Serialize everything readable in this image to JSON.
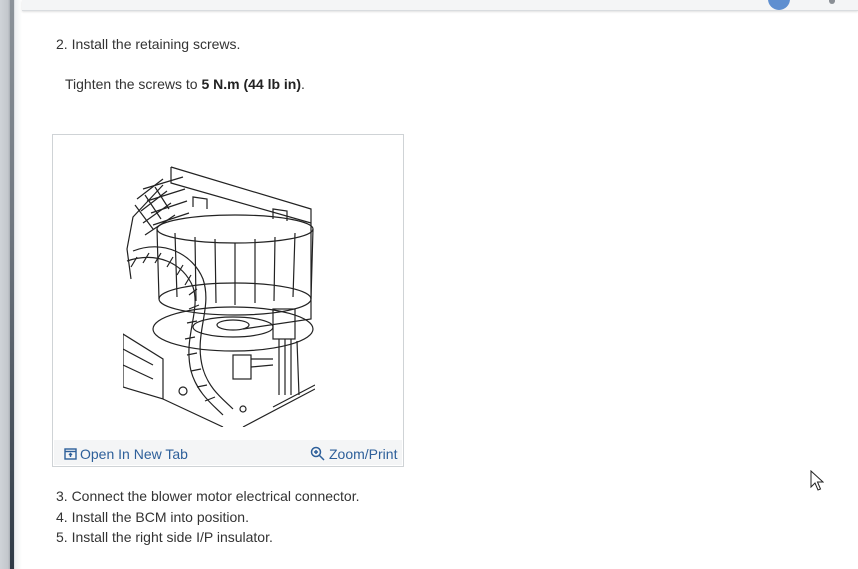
{
  "steps": {
    "step2": "2. Install the retaining screws.",
    "torque_prefix": "Tighten the screws to ",
    "torque_value": "5 N.m (44 lb in)",
    "torque_suffix": ".",
    "step3": "3. Connect the blower motor electrical connector.",
    "step4": "4. Install the BCM into position.",
    "step5": "5. Install the right side I/P insulator."
  },
  "figure": {
    "open_new_tab": "Open In New Tab",
    "zoom_print": "Zoom/Print",
    "icons": [
      "open-tab-icon",
      "zoom-icon"
    ]
  },
  "colors": {
    "link": "#2d5f9a",
    "text": "#333333",
    "accent": "#5f8fd0"
  }
}
